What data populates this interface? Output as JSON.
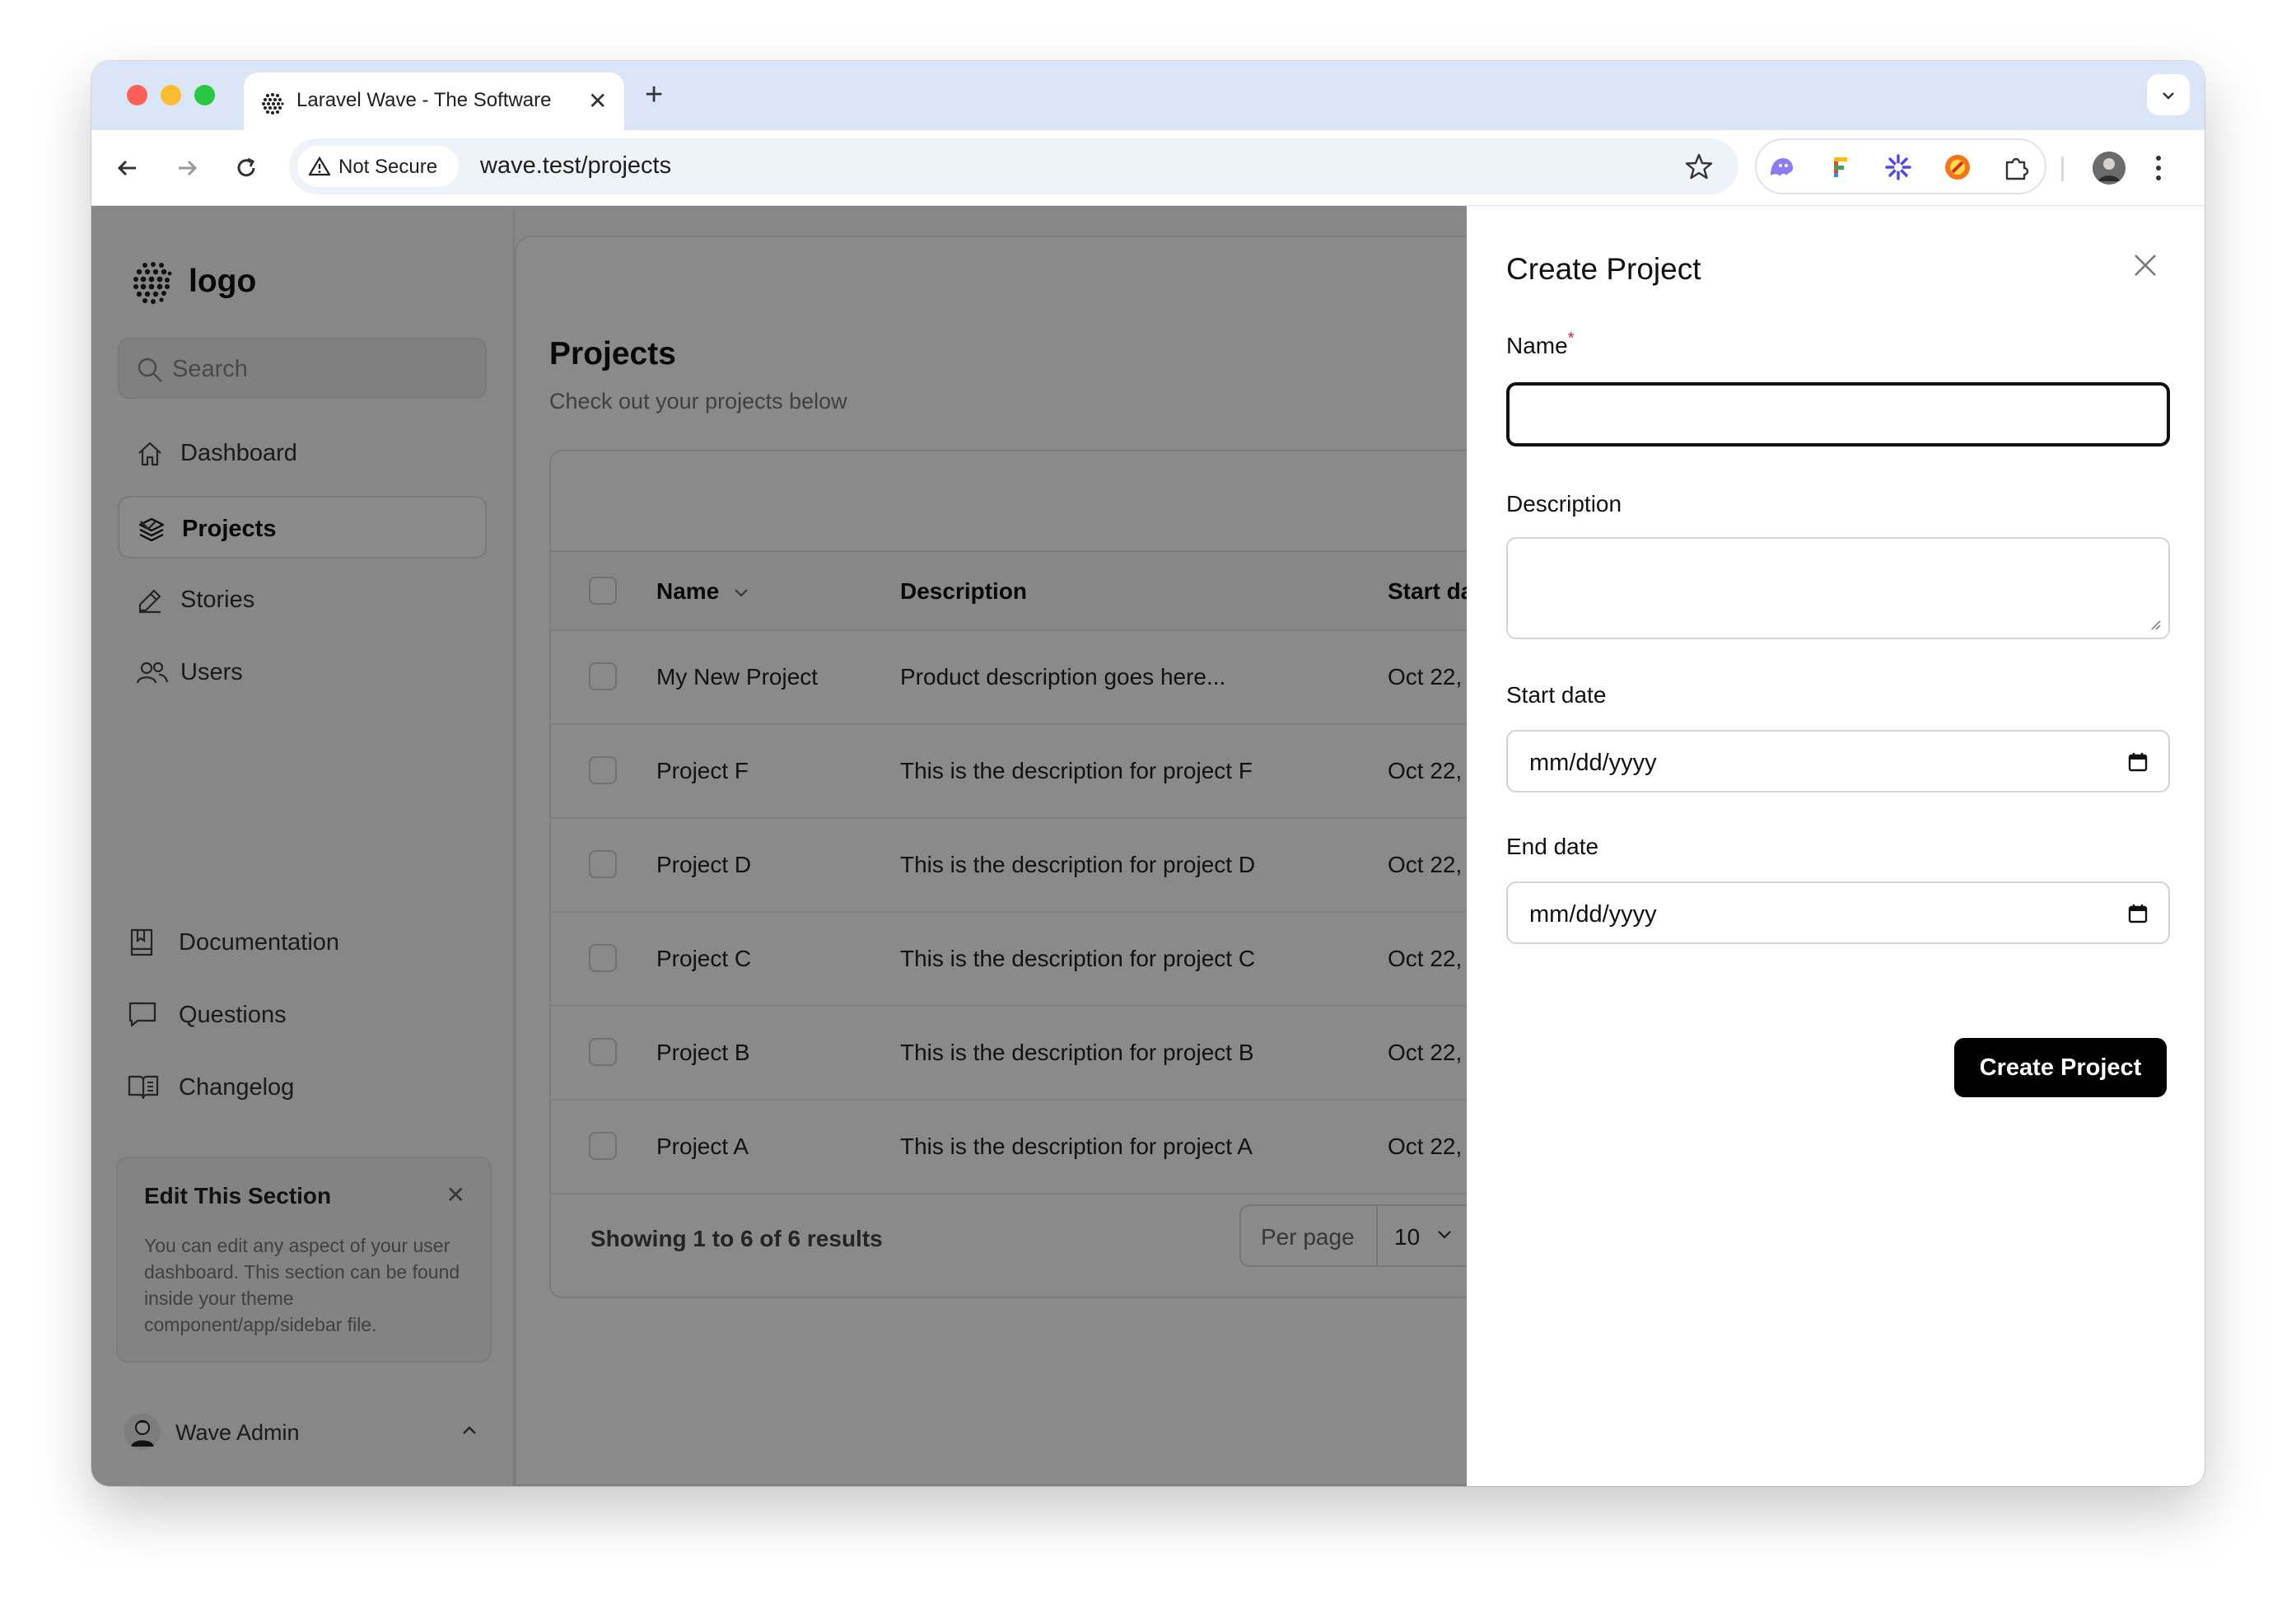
{
  "browser": {
    "tab_title": "Laravel Wave - The Software",
    "new_tab_symbol": "+",
    "tab_close_symbol": "✕",
    "security_label": "Not Secure",
    "url": "wave.test/projects"
  },
  "sidebar": {
    "logo_text": "logo",
    "search_placeholder": "Search",
    "nav": [
      {
        "label": "Dashboard",
        "icon": "home-icon"
      },
      {
        "label": "Projects",
        "icon": "layers-icon",
        "active": true
      },
      {
        "label": "Stories",
        "icon": "pencil-icon"
      },
      {
        "label": "Users",
        "icon": "users-icon"
      }
    ],
    "secondary": [
      {
        "label": "Documentation",
        "icon": "book-icon"
      },
      {
        "label": "Questions",
        "icon": "chat-icon"
      },
      {
        "label": "Changelog",
        "icon": "open-book-icon"
      }
    ],
    "edit_card": {
      "title": "Edit This Section",
      "close_symbol": "✕",
      "body": "You can edit any aspect of your user dashboard. This section can be found inside your theme component/app/sidebar file."
    },
    "user_name": "Wave Admin"
  },
  "main": {
    "title": "Projects",
    "subtitle": "Check out your projects below",
    "columns": [
      "Name",
      "Description",
      "Start da"
    ],
    "rows": [
      {
        "name": "My New Project",
        "description": "Product description goes here...",
        "start": "Oct 22,"
      },
      {
        "name": "Project F",
        "description": "This is the description for project F",
        "start": "Oct 22,"
      },
      {
        "name": "Project D",
        "description": "This is the description for project D",
        "start": "Oct 22,"
      },
      {
        "name": "Project C",
        "description": "This is the description for project C",
        "start": "Oct 22,"
      },
      {
        "name": "Project B",
        "description": "This is the description for project B",
        "start": "Oct 22,"
      },
      {
        "name": "Project A",
        "description": "This is the description for project A",
        "start": "Oct 22,"
      }
    ],
    "results_text": "Showing 1 to 6 of 6 results",
    "per_page_label": "Per page",
    "per_page_value": "10"
  },
  "panel": {
    "title": "Create Project",
    "name_label": "Name",
    "required_mark": "*",
    "name_value": "",
    "description_label": "Description",
    "description_value": "",
    "start_label": "Start date",
    "start_placeholder": "mm/dd/yyyy",
    "end_label": "End date",
    "end_placeholder": "mm/dd/yyyy",
    "submit_label": "Create Project"
  },
  "colors": {
    "accent": "#000000",
    "overlay": "rgba(0,0,0,0.46)",
    "required": "#e11d48",
    "tabbar": "#dbe5f8"
  }
}
